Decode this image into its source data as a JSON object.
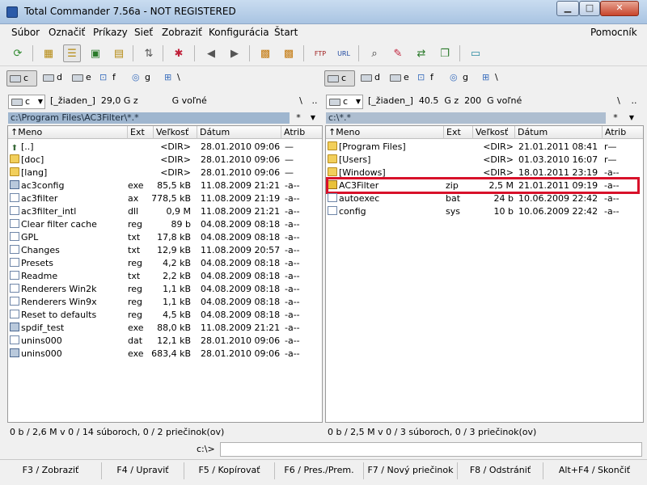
{
  "window": {
    "title": "Total Commander 7.56a - NOT REGISTERED",
    "min": "▁",
    "max": "□",
    "close": "✕"
  },
  "menu": [
    "Súbor",
    "Označiť",
    "Príkazy",
    "Sieť",
    "Zobraziť",
    "Konfigurácia",
    "Štart"
  ],
  "menu_help": "Pomocník",
  "drives_left": [
    {
      "letter": "c",
      "selected": true
    },
    {
      "letter": "d"
    },
    {
      "letter": "e"
    },
    {
      "letter": "f"
    },
    {
      "letter": "g"
    },
    {
      "letter": "\\",
      "network": true
    }
  ],
  "drives_right": [
    {
      "letter": "c",
      "selected": true
    },
    {
      "letter": "d"
    },
    {
      "letter": "e"
    },
    {
      "letter": "f"
    },
    {
      "letter": "g"
    },
    {
      "letter": "\\",
      "network": true
    }
  ],
  "left": {
    "drive": "c",
    "info": "[_žiaden_]  29,0 G z            G voľné",
    "path": "c:\\Program Files\\AC3Filter\\*.*",
    "root_btn": "\\",
    "up_btn": "..",
    "filter_btn": "*",
    "columns": {
      "name": "↑Meno",
      "ext": "Ext",
      "size": "Veľkosť",
      "date": "Dátum",
      "attr": "Atrib"
    },
    "files": [
      {
        "icon": "up",
        "name": "[..]",
        "ext": "",
        "size": "<DIR>",
        "date": "28.01.2010 09:06",
        "attr": "—"
      },
      {
        "icon": "folder",
        "name": "[doc]",
        "ext": "",
        "size": "<DIR>",
        "date": "28.01.2010 09:06",
        "attr": "—"
      },
      {
        "icon": "folder",
        "name": "[lang]",
        "ext": "",
        "size": "<DIR>",
        "date": "28.01.2010 09:06",
        "attr": "—"
      },
      {
        "icon": "exe",
        "name": "ac3config",
        "ext": "exe",
        "size": "85,5 kB",
        "date": "11.08.2009 21:21",
        "attr": "-a--"
      },
      {
        "icon": "file",
        "name": "ac3filter",
        "ext": "ax",
        "size": "778,5 kB",
        "date": "11.08.2009 21:19",
        "attr": "-a--"
      },
      {
        "icon": "file",
        "name": "ac3filter_intl",
        "ext": "dll",
        "size": "0,9 M",
        "date": "11.08.2009 21:21",
        "attr": "-a--"
      },
      {
        "icon": "file",
        "name": "Clear filter cache",
        "ext": "reg",
        "size": "89 b",
        "date": "04.08.2009 08:18",
        "attr": "-a--"
      },
      {
        "icon": "file",
        "name": "GPL",
        "ext": "txt",
        "size": "17,8 kB",
        "date": "04.08.2009 08:18",
        "attr": "-a--"
      },
      {
        "icon": "file",
        "name": "Changes",
        "ext": "txt",
        "size": "12,9 kB",
        "date": "11.08.2009 20:57",
        "attr": "-a--"
      },
      {
        "icon": "file",
        "name": "Presets",
        "ext": "reg",
        "size": "4,2 kB",
        "date": "04.08.2009 08:18",
        "attr": "-a--"
      },
      {
        "icon": "file",
        "name": "Readme",
        "ext": "txt",
        "size": "2,2 kB",
        "date": "04.08.2009 08:18",
        "attr": "-a--"
      },
      {
        "icon": "file",
        "name": "Renderers Win2k",
        "ext": "reg",
        "size": "1,1 kB",
        "date": "04.08.2009 08:18",
        "attr": "-a--"
      },
      {
        "icon": "file",
        "name": "Renderers Win9x",
        "ext": "reg",
        "size": "1,1 kB",
        "date": "04.08.2009 08:18",
        "attr": "-a--"
      },
      {
        "icon": "file",
        "name": "Reset to defaults",
        "ext": "reg",
        "size": "4,5 kB",
        "date": "04.08.2009 08:18",
        "attr": "-a--"
      },
      {
        "icon": "exe",
        "name": "spdif_test",
        "ext": "exe",
        "size": "88,0 kB",
        "date": "11.08.2009 21:21",
        "attr": "-a--"
      },
      {
        "icon": "file",
        "name": "unins000",
        "ext": "dat",
        "size": "12,1 kB",
        "date": "28.01.2010 09:06",
        "attr": "-a--"
      },
      {
        "icon": "exe",
        "name": "unins000",
        "ext": "exe",
        "size": "683,4 kB",
        "date": "28.01.2010 09:06",
        "attr": "-a--"
      }
    ],
    "status": "0 b / 2,6 M v 0 / 14 súboroch, 0 / 2 priečinok(ov)"
  },
  "right": {
    "drive": "c",
    "info": "[_žiaden_]  40.5  G z  200  G voľné",
    "path": "c:\\*.*",
    "root_btn": "\\",
    "up_btn": "..",
    "filter_btn": "*",
    "columns": {
      "name": "↑Meno",
      "ext": "Ext",
      "size": "Veľkosť",
      "date": "Dátum",
      "attr": "Atrib"
    },
    "files": [
      {
        "icon": "folder",
        "name": "[Program Files]",
        "ext": "",
        "size": "<DIR>",
        "date": "21.01.2011 08:41",
        "attr": "r—"
      },
      {
        "icon": "folder",
        "name": "[Users]",
        "ext": "",
        "size": "<DIR>",
        "date": "01.03.2010 16:07",
        "attr": "r—"
      },
      {
        "icon": "folder",
        "name": "[Windows]",
        "ext": "",
        "size": "<DIR>",
        "date": "18.01.2011 23:19",
        "attr": "-a--"
      },
      {
        "icon": "zip",
        "name": "AC3Filter",
        "ext": "zip",
        "size": "2,5 M",
        "date": "21.01.2011 09:19",
        "attr": "-a--",
        "highlighted": true
      },
      {
        "icon": "file",
        "name": "autoexec",
        "ext": "bat",
        "size": "24 b",
        "date": "10.06.2009 22:42",
        "attr": "-a--"
      },
      {
        "icon": "file",
        "name": "config",
        "ext": "sys",
        "size": "10 b",
        "date": "10.06.2009 22:42",
        "attr": "-a--"
      }
    ],
    "status": "0 b / 2,5 M v 0 / 3 súboroch, 0 / 3 priečinok(ov)"
  },
  "command": {
    "prompt": "c:\\>",
    "value": ""
  },
  "fkeys": [
    "F3 / Zobraziť",
    "F4 / Upraviť",
    "F5 / Kopírovať",
    "F6 / Pres./Prem.",
    "F7 / Nový priečinok",
    "F8 / Odstrániť",
    "Alt+F4 / Skončiť"
  ],
  "toolbar_icons": [
    "refresh-icon",
    "brief-view-icon",
    "full-view-icon",
    "thumbnail-view-icon",
    "tree-view-icon",
    "invert-selection-icon",
    "compare-icon",
    "back-icon",
    "forward-icon",
    "pack-icon",
    "unpack-icon",
    "ftp-connect-icon",
    "url-connect-icon",
    "find-files-icon",
    "multi-rename-icon",
    "sync-dirs-icon",
    "copy-names-icon",
    "notepad-icon"
  ]
}
